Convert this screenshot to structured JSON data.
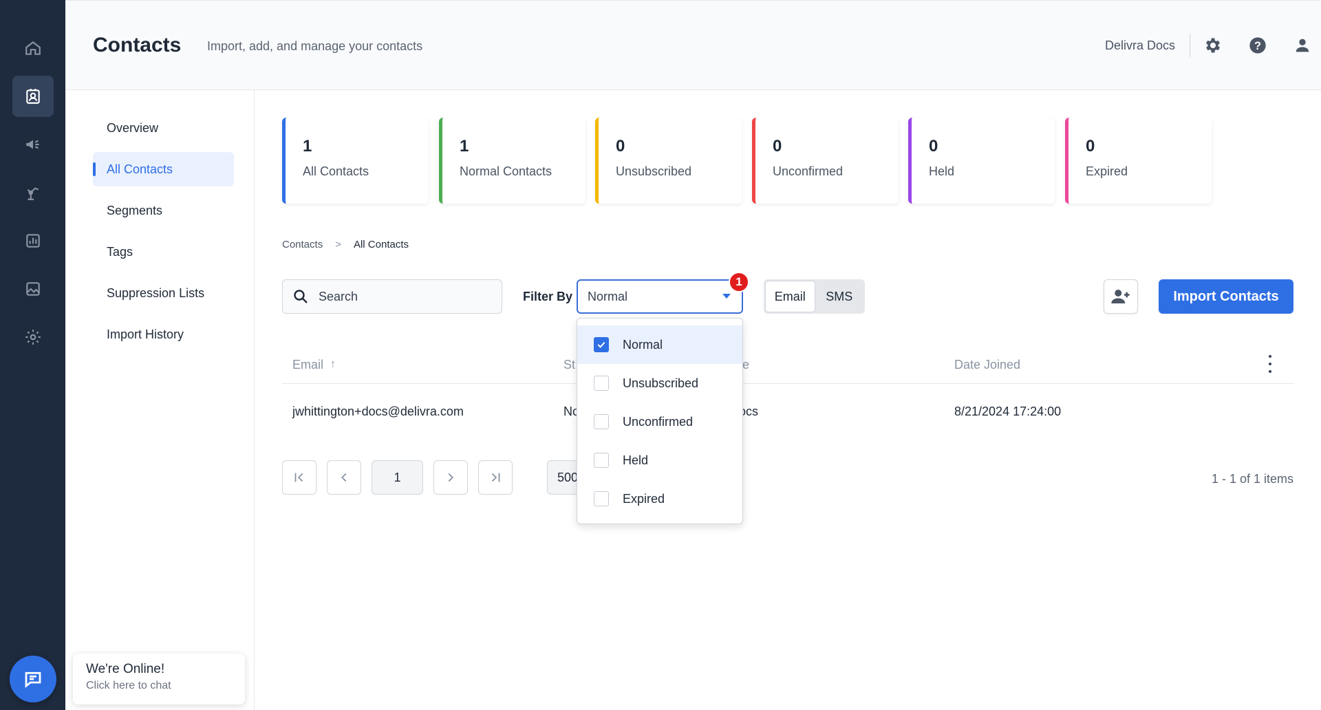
{
  "header": {
    "title": "Contacts",
    "subtitle": "Import, add, and manage your contacts",
    "account_name": "Delivra Docs",
    "icons": [
      "gear-icon",
      "help-icon",
      "user-icon"
    ]
  },
  "rail": {
    "items": [
      "home-icon",
      "contacts-icon",
      "megaphone-icon",
      "automation-icon",
      "reports-icon",
      "image-icon",
      "settings-icon"
    ],
    "active": "contacts-icon"
  },
  "subnav": {
    "items": [
      {
        "label": "Overview"
      },
      {
        "label": "All Contacts"
      },
      {
        "label": "Segments"
      },
      {
        "label": "Tags"
      },
      {
        "label": "Suppression Lists"
      },
      {
        "label": "Import History"
      }
    ],
    "active": "All Contacts"
  },
  "stats": [
    {
      "value": "1",
      "label": "All Contacts",
      "color": "#2f6fe4"
    },
    {
      "value": "1",
      "label": "Normal Contacts",
      "color": "#4caf50"
    },
    {
      "value": "0",
      "label": "Unsubscribed",
      "color": "#f5b800"
    },
    {
      "value": "0",
      "label": "Unconfirmed",
      "color": "#ef4444"
    },
    {
      "value": "0",
      "label": "Held",
      "color": "#9b46e8"
    },
    {
      "value": "0",
      "label": "Expired",
      "color": "#ec4899"
    }
  ],
  "breadcrumb": {
    "parent": "Contacts",
    "separator": ">",
    "current": "All Contacts"
  },
  "toolbar": {
    "search_placeholder": "Search",
    "filter_label": "Filter By",
    "filter_value": "Normal",
    "filter_badge": "1",
    "channel_options": [
      "Email",
      "SMS"
    ],
    "channel_active": "Email",
    "import_label": "Import Contacts"
  },
  "table": {
    "columns": [
      "Email",
      "St",
      "e",
      "Date Joined"
    ],
    "sort_indicator": "↑",
    "rows": [
      {
        "email": "jwhittington+docs@delivra.com",
        "status": "Nc",
        "source": "ocs",
        "date_joined": "8/21/2024 17:24:00"
      }
    ]
  },
  "filter_dropdown": {
    "options": [
      {
        "label": "Normal",
        "checked": true
      },
      {
        "label": "Unsubscribed",
        "checked": false
      },
      {
        "label": "Unconfirmed",
        "checked": false
      },
      {
        "label": "Held",
        "checked": false
      },
      {
        "label": "Expired",
        "checked": false
      }
    ]
  },
  "pagination": {
    "current_page": "1",
    "page_size": "500",
    "summary": "1 - 1 of 1 items"
  },
  "chat": {
    "title": "We're Online!",
    "subtitle": "Click here to chat"
  }
}
